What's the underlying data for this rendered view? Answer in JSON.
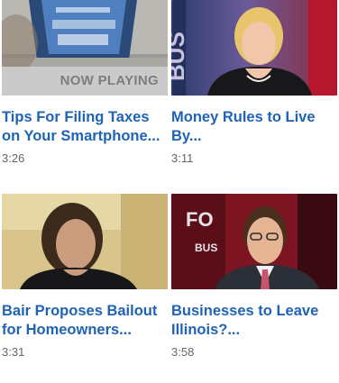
{
  "videos": [
    {
      "title": "Tips For Filing Taxes on Your Smartphone...",
      "duration": "3:26",
      "now_playing_label": "NOW PLAYING",
      "is_now_playing": true,
      "thumb_icon": "smartphone-screen-thumbnail"
    },
    {
      "title": "Money Rules to Live By...",
      "duration": "3:11",
      "now_playing_label": "",
      "is_now_playing": false,
      "thumb_icon": "woman-anchor-thumbnail"
    },
    {
      "title": "Bair Proposes Bailout for Homeowners...",
      "duration": "3:31",
      "now_playing_label": "",
      "is_now_playing": false,
      "thumb_icon": "woman-interview-thumbnail"
    },
    {
      "title": "Businesses to Leave Illinois?...",
      "duration": "3:58",
      "now_playing_label": "",
      "is_now_playing": false,
      "thumb_icon": "man-studio-thumbnail"
    }
  ],
  "colors": {
    "link_blue": "#1f63b5",
    "duration_gray": "#666666",
    "now_playing_bg": "#cdcdcd",
    "now_playing_text": "#7d7d7d"
  }
}
